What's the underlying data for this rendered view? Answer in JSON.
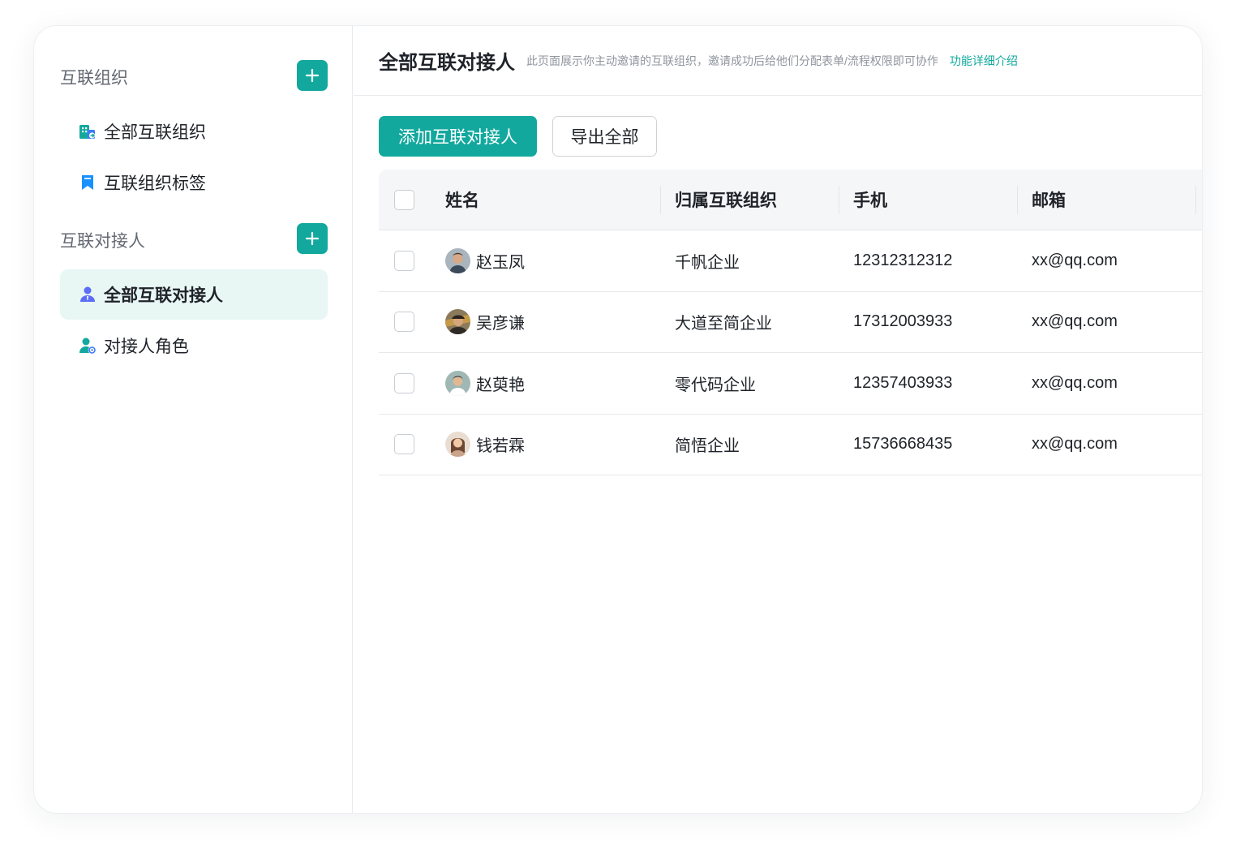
{
  "sidebar": {
    "org_group_title": "互联组织",
    "org_items": [
      {
        "label": "全部互联组织",
        "icon": "building-icon"
      },
      {
        "label": "互联组织标签",
        "icon": "bookmark-icon"
      }
    ],
    "contact_group_title": "互联对接人",
    "contact_items": [
      {
        "label": "全部互联对接人",
        "icon": "user-icon",
        "active": true
      },
      {
        "label": "对接人角色",
        "icon": "user-role-icon"
      }
    ]
  },
  "header": {
    "title": "全部互联对接人",
    "description": "此页面展示你主动邀请的互联组织，邀请成功后给他们分配表单/流程权限即可协作",
    "link": "功能详细介绍"
  },
  "toolbar": {
    "add_label": "添加互联对接人",
    "export_label": "导出全部"
  },
  "table": {
    "columns": [
      "姓名",
      "归属互联组织",
      "手机",
      "邮箱"
    ],
    "rows": [
      {
        "name": "赵玉凤",
        "org": "千帆企业",
        "phone": "12312312312",
        "email": "xx@qq.com"
      },
      {
        "name": "吴彦谦",
        "org": "大道至简企业",
        "phone": "17312003933",
        "email": "xx@qq.com"
      },
      {
        "name": "赵萸艳",
        "org": "零代码企业",
        "phone": "12357403933",
        "email": "xx@qq.com"
      },
      {
        "name": "钱若霖",
        "org": "简悟企业",
        "phone": "15736668435",
        "email": "xx@qq.com"
      }
    ]
  },
  "colors": {
    "accent": "#13a89e",
    "active_bg": "#e8f6f4",
    "icon_blue": "#3d7bf7",
    "icon_purple": "#5b6ef5"
  }
}
